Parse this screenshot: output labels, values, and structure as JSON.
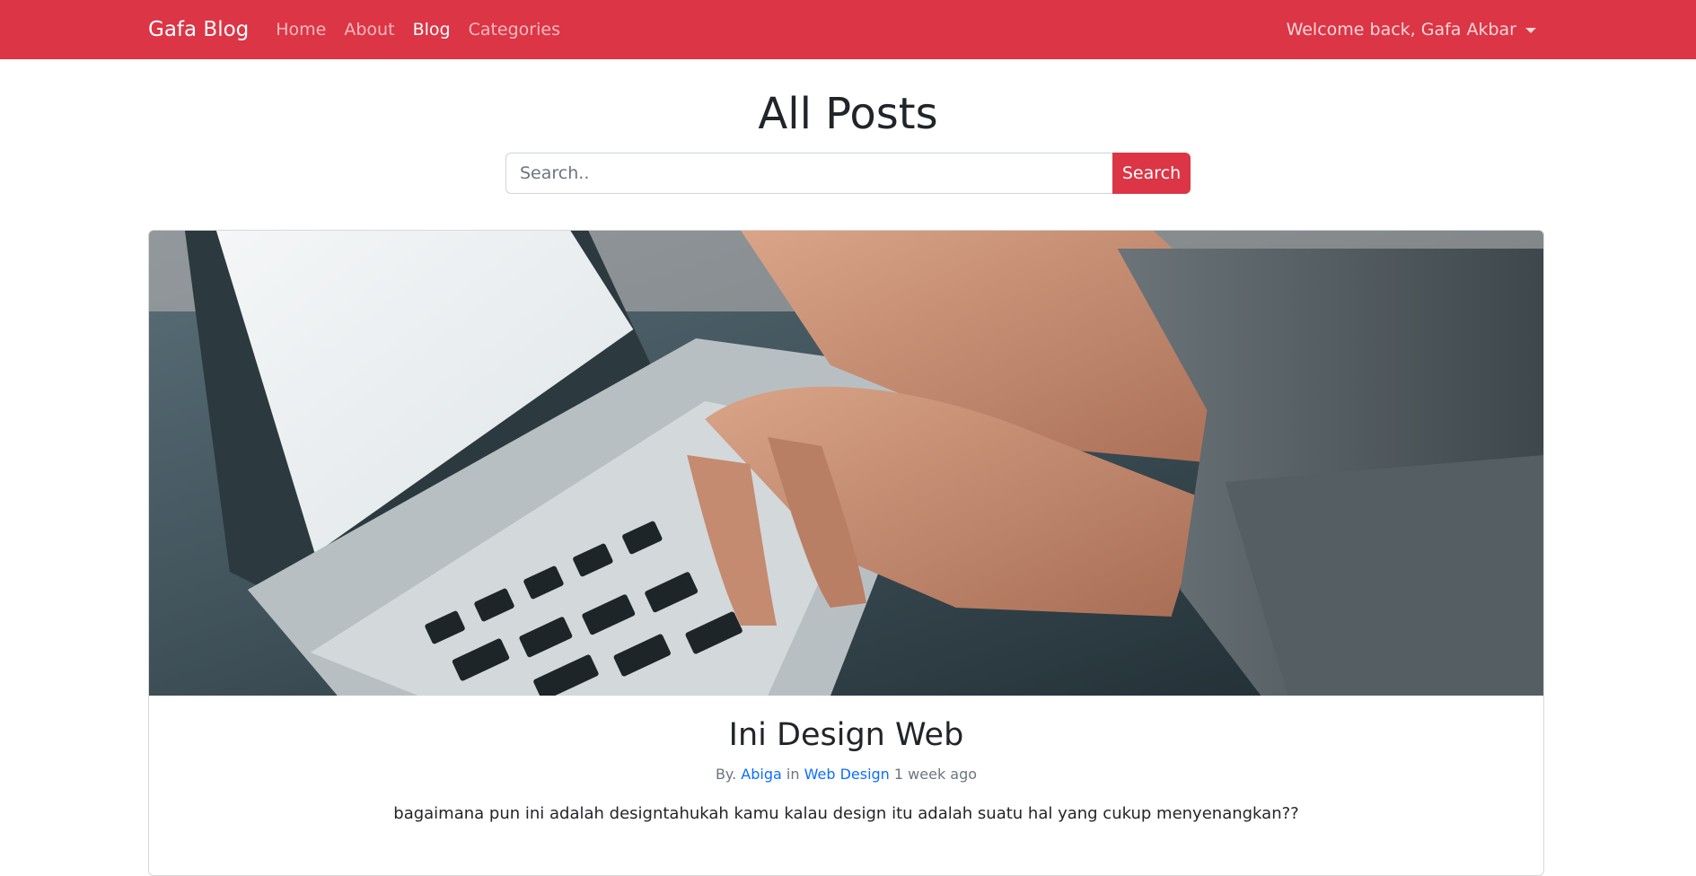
{
  "navbar": {
    "brand": "Gafa Blog",
    "links": [
      {
        "label": "Home"
      },
      {
        "label": "About"
      },
      {
        "label": "Blog"
      },
      {
        "label": "Categories"
      }
    ],
    "user_menu": "Welcome back, Gafa Akbar",
    "accent": "#dc3545"
  },
  "page": {
    "title": "All Posts"
  },
  "search": {
    "placeholder": "Search..",
    "button": "Search"
  },
  "post": {
    "title": "Ini Design Web",
    "by_prefix": "By.",
    "author": "Abiga",
    "in_word": "in",
    "category": "Web Design",
    "time": "1 week ago",
    "excerpt": "bagaimana pun ini adalah designtahukah kamu kalau design itu adalah suatu hal yang cukup menyenangkan??"
  }
}
